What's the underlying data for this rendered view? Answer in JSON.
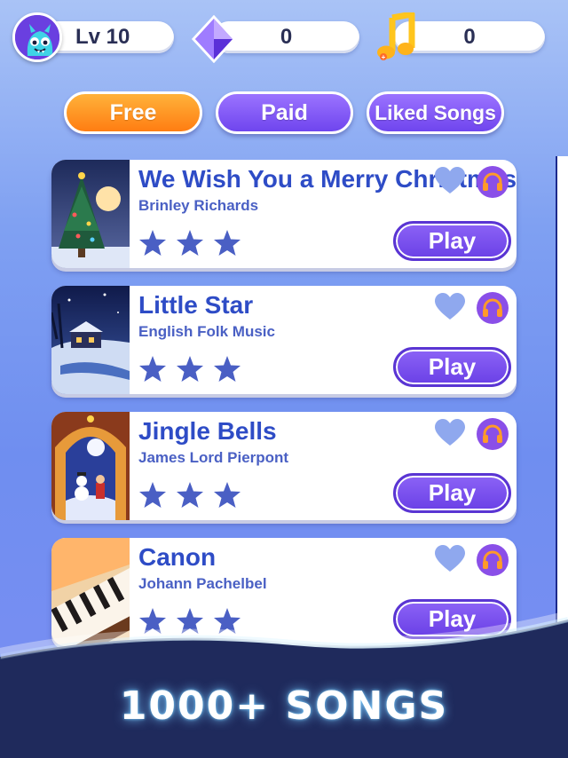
{
  "header": {
    "level_label": "Lv 10",
    "gems": "0",
    "notes": "0"
  },
  "tabs": [
    {
      "label": "Free",
      "active": true
    },
    {
      "label": "Paid",
      "active": false
    },
    {
      "label": "Liked Songs",
      "active": false
    }
  ],
  "songs": [
    {
      "title": "We Wish You a Merry Christmas",
      "artist": "Brinley Richards",
      "stars": 3,
      "play_label": "Play"
    },
    {
      "title": "Little Star",
      "artist": "English Folk Music",
      "stars": 3,
      "play_label": "Play"
    },
    {
      "title": "Jingle Bells",
      "artist": "James Lord Pierpont",
      "stars": 3,
      "play_label": "Play"
    },
    {
      "title": "Canon",
      "artist": "Johann Pachelbel",
      "stars": 3,
      "play_label": "Play"
    }
  ],
  "banner": {
    "text": "1000+ SONGS"
  },
  "colors": {
    "accent_orange": "#ff8a1e",
    "accent_purple": "#7a52f0",
    "title_blue": "#2e4cc6",
    "star_blue": "#4a5fc4",
    "banner_navy": "#1f2a5c"
  }
}
